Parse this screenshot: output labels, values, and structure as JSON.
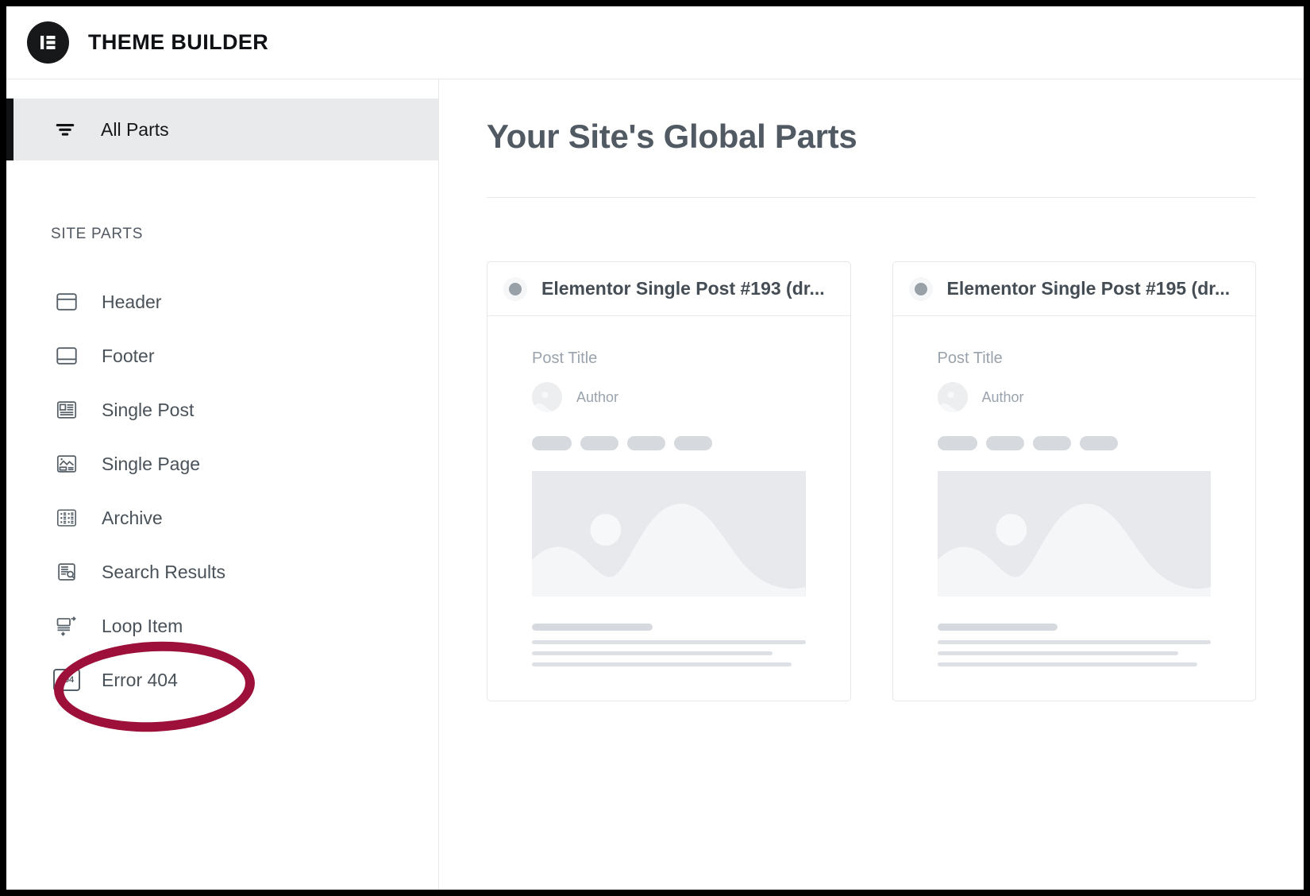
{
  "app": {
    "title": "THEME BUILDER",
    "logo_icon": "elementor-logo-icon"
  },
  "sidebar": {
    "all_parts": {
      "label": "All Parts",
      "icon": "filter-icon",
      "active": true
    },
    "section_label": "SITE PARTS",
    "items": [
      {
        "label": "Header",
        "icon": "header-layout-icon"
      },
      {
        "label": "Footer",
        "icon": "footer-layout-icon"
      },
      {
        "label": "Single Post",
        "icon": "single-post-icon"
      },
      {
        "label": "Single Page",
        "icon": "single-page-icon"
      },
      {
        "label": "Archive",
        "icon": "archive-grid-icon"
      },
      {
        "label": "Search Results",
        "icon": "search-results-icon"
      },
      {
        "label": "Loop Item",
        "icon": "loop-item-icon"
      },
      {
        "label": "Error 404",
        "icon": "error-404-icon",
        "icon_text": "404"
      }
    ],
    "annotation": {
      "shape": "ellipse",
      "target": "Search Results",
      "color": "#9c1039"
    }
  },
  "main": {
    "page_title": "Your Site's Global Parts",
    "cards": [
      {
        "title": "Elementor Single Post #193 (dr...",
        "status_dot": "draft-status-dot",
        "preview": {
          "post_title": "Post Title",
          "author": "Author"
        }
      },
      {
        "title": "Elementor Single Post #195 (dr...",
        "status_dot": "draft-status-dot",
        "preview": {
          "post_title": "Post Title",
          "author": "Author"
        }
      }
    ]
  },
  "colors": {
    "accent_dark": "#101214",
    "text_muted": "#4a5259",
    "annotation": "#9c1039",
    "placeholder": "#d6dadf"
  }
}
